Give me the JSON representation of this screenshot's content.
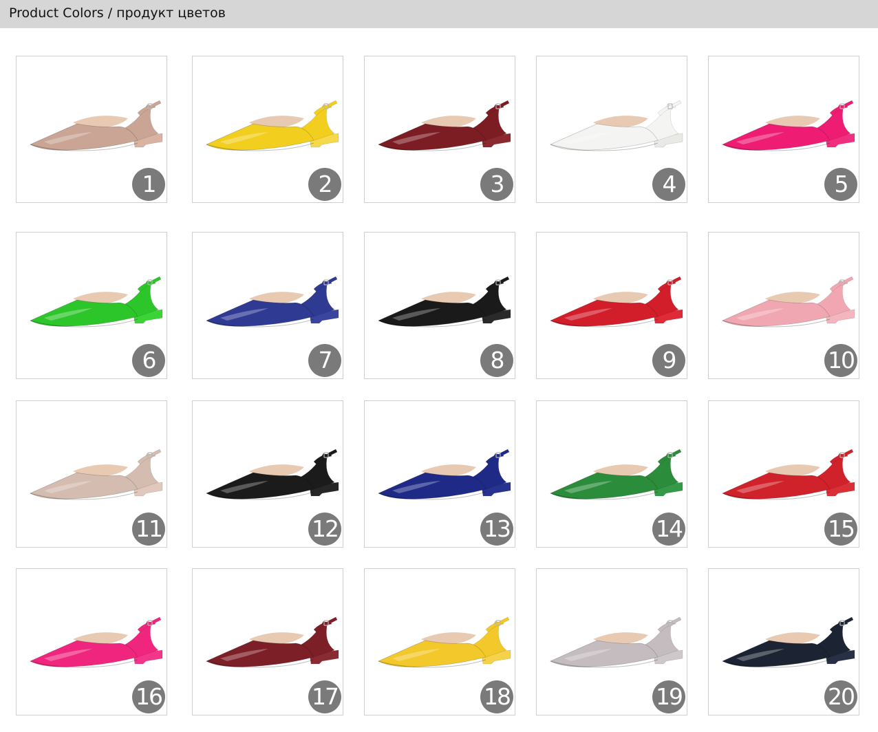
{
  "header": {
    "title": "Product Colors / продукт цветов"
  },
  "colors": [
    {
      "number": "1",
      "color": "#caa494",
      "sole": "#d9b2a2"
    },
    {
      "number": "2",
      "color": "#f2cf1e",
      "sole": "#f5d94a"
    },
    {
      "number": "3",
      "color": "#7c1d24",
      "sole": "#8a2a30"
    },
    {
      "number": "4",
      "color": "#f4f4f2",
      "sole": "#e9e9e6"
    },
    {
      "number": "5",
      "color": "#ee1c72",
      "sole": "#f0307f"
    },
    {
      "number": "6",
      "color": "#2dc62a",
      "sole": "#3bd336"
    },
    {
      "number": "7",
      "color": "#2f3a93",
      "sole": "#3a45a0"
    },
    {
      "number": "8",
      "color": "#1a1a1a",
      "sole": "#2a2a2a"
    },
    {
      "number": "9",
      "color": "#d21d2a",
      "sole": "#df2b37"
    },
    {
      "number": "10",
      "color": "#f1a7b2",
      "sole": "#f3b5be"
    },
    {
      "number": "11",
      "color": "#d5bcb1",
      "sole": "#e0c8bd"
    },
    {
      "number": "12",
      "color": "#1b1b1b",
      "sole": "#262626"
    },
    {
      "number": "13",
      "color": "#1e2a86",
      "sole": "#27338f"
    },
    {
      "number": "14",
      "color": "#2b8c3b",
      "sole": "#35994a"
    },
    {
      "number": "15",
      "color": "#d0222a",
      "sole": "#db2f37"
    },
    {
      "number": "16",
      "color": "#f0267e",
      "sole": "#f2378b"
    },
    {
      "number": "17",
      "color": "#7d1f27",
      "sole": "#8a2b33"
    },
    {
      "number": "18",
      "color": "#f3c82a",
      "sole": "#f5d24a"
    },
    {
      "number": "19",
      "color": "#c4bcbf",
      "sole": "#cfc8cb"
    },
    {
      "number": "20",
      "color": "#1c2433",
      "sole": "#273044"
    }
  ]
}
